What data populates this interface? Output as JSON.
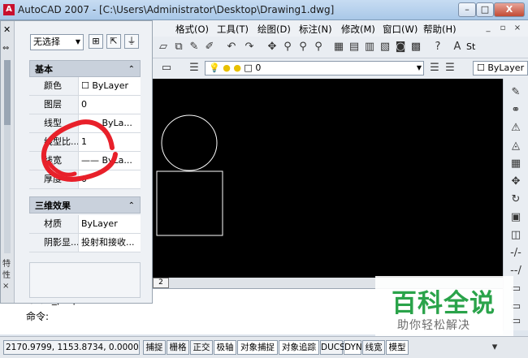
{
  "window": {
    "title": "AutoCAD 2007 - [C:\\Users\\Administrator\\Desktop\\Drawing1.dwg]",
    "min": "–",
    "max": "□",
    "close": "X"
  },
  "menu": [
    "格式(O)",
    "工具(T)",
    "绘图(D)",
    "标注(N)",
    "修改(M)",
    "窗口(W)",
    "帮助(H)"
  ],
  "mdi": {
    "min": "_",
    "restore": "▫",
    "close": "×"
  },
  "toolbar2": {
    "layer_value": "0",
    "color_value": "ByLayer"
  },
  "toolbar1": {
    "style_value": "St"
  },
  "palette": {
    "selection": "无选择",
    "sections": [
      {
        "title": "基本",
        "rows": [
          {
            "label": "颜色",
            "value": "☐ ByLayer"
          },
          {
            "label": "图层",
            "value": "0"
          },
          {
            "label": "线型",
            "value": "—— ByLa..."
          },
          {
            "label": "线型比...",
            "value": "1"
          },
          {
            "label": "线宽",
            "value": "—— ByLa..."
          },
          {
            "label": "厚度",
            "value": "0"
          }
        ]
      },
      {
        "title": "三维效果",
        "rows": [
          {
            "label": "材质",
            "value": "ByLayer"
          },
          {
            "label": "阴影显...",
            "value": "投射和接收..."
          }
        ]
      }
    ],
    "strip_labels": [
      "特",
      "性",
      "×"
    ]
  },
  "tabs": {
    "layout2": "2"
  },
  "command": {
    "line1": "命令: _properties",
    "line2": "命令:"
  },
  "status": {
    "coords": "2170.9799, 1153.8734, 0.0000",
    "buttons": [
      "捕捉",
      "栅格",
      "正交",
      "极轴",
      "对象捕捉",
      "对象追踪",
      "DUCS",
      "DYN",
      "线宽",
      "模型"
    ]
  },
  "watermark": {
    "brand": "百科全说",
    "slogan": "助你轻松解决"
  },
  "colors": {
    "canvas": "#000000",
    "annotation": "#e8202a",
    "watermark_green": "#2aa34a"
  }
}
